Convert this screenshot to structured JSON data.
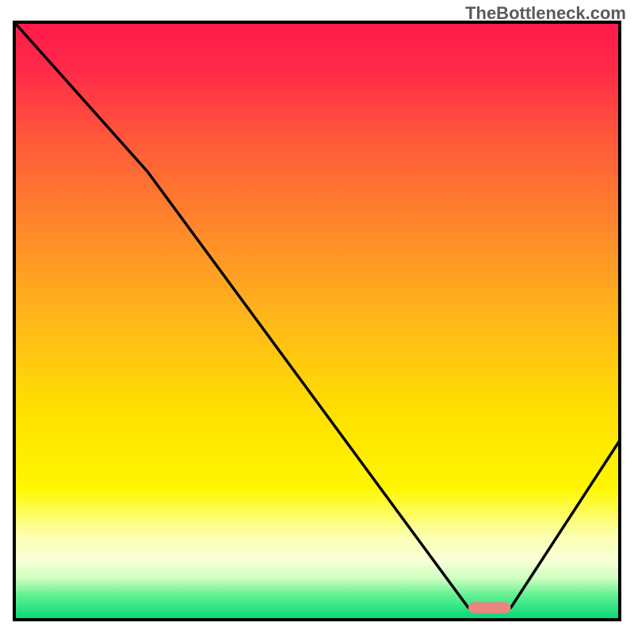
{
  "watermark": "TheBottleneck.com",
  "chart_data": {
    "type": "line",
    "title": "",
    "xlabel": "",
    "ylabel": "",
    "xlim": [
      0,
      100
    ],
    "ylim": [
      0,
      100
    ],
    "x": [
      0,
      22,
      75,
      82,
      100
    ],
    "values": [
      100,
      75,
      2,
      2,
      30
    ],
    "marker": {
      "x_start": 75,
      "x_end": 82,
      "y": 2
    },
    "gradient_stops": [
      {
        "offset": 0.0,
        "color": "#ff1a4a"
      },
      {
        "offset": 0.08,
        "color": "#ff2a48"
      },
      {
        "offset": 0.2,
        "color": "#ff5a3a"
      },
      {
        "offset": 0.35,
        "color": "#ff8a2a"
      },
      {
        "offset": 0.5,
        "color": "#ffb81a"
      },
      {
        "offset": 0.65,
        "color": "#ffe000"
      },
      {
        "offset": 0.78,
        "color": "#fff700"
      },
      {
        "offset": 0.86,
        "color": "#fcffb0"
      },
      {
        "offset": 0.9,
        "color": "#f8ffd8"
      },
      {
        "offset": 0.93,
        "color": "#d0ffc0"
      },
      {
        "offset": 0.96,
        "color": "#60f090"
      },
      {
        "offset": 1.0,
        "color": "#00d878"
      }
    ],
    "marker_color": "#e8867f",
    "line_color": "#000000",
    "border_color": "#000000"
  }
}
